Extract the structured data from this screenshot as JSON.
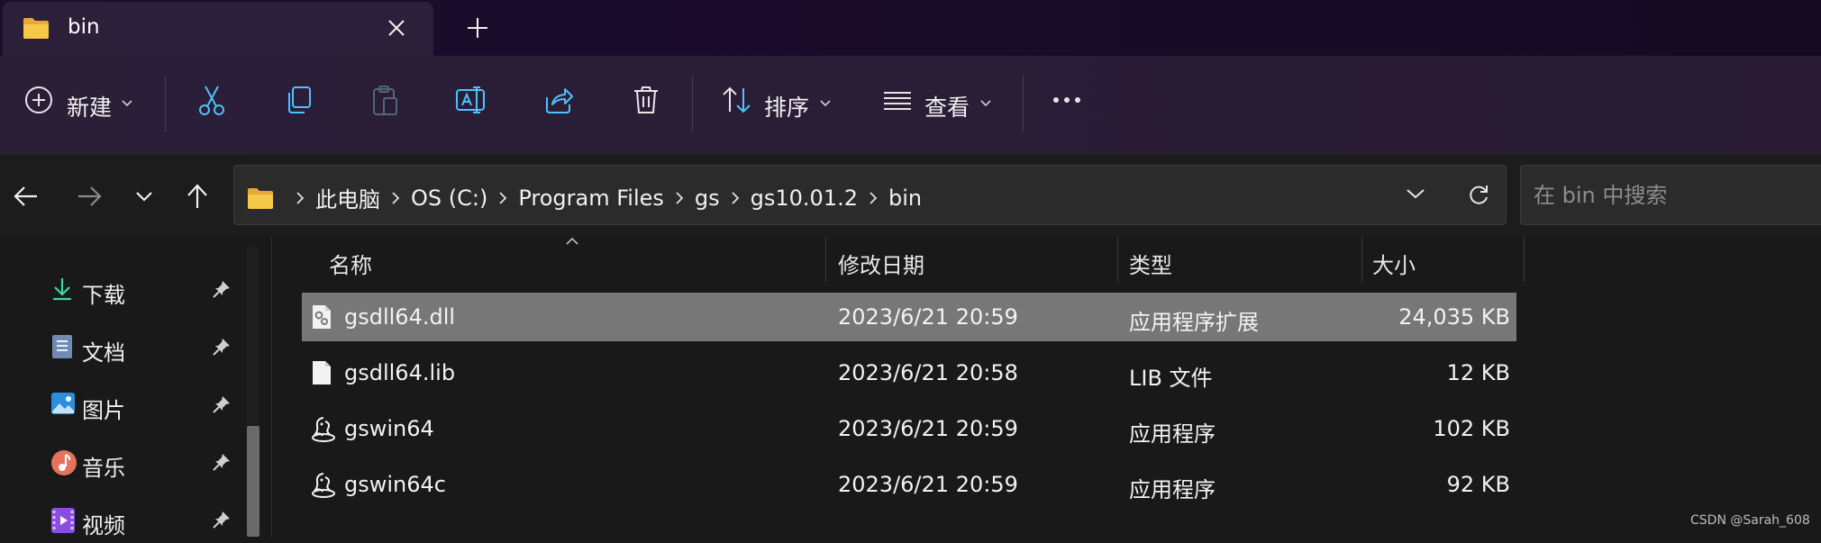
{
  "tab": {
    "title": "bin",
    "icon": "folder-icon"
  },
  "toolbar": {
    "new_label": "新建",
    "sort_label": "排序",
    "view_label": "查看",
    "icons": [
      "new-icon",
      "cut-icon",
      "copy-icon",
      "paste-icon",
      "rename-icon",
      "share-icon",
      "delete-icon",
      "sort-icon",
      "view-icon",
      "more-icon"
    ]
  },
  "address": {
    "crumbs": [
      "此电脑",
      "OS (C:)",
      "Program Files",
      "gs",
      "gs10.01.2",
      "bin"
    ]
  },
  "search": {
    "placeholder": "在 bin 中搜索"
  },
  "sidebar": {
    "items": [
      {
        "label": "下载",
        "icon": "download-icon"
      },
      {
        "label": "文档",
        "icon": "document-icon"
      },
      {
        "label": "图片",
        "icon": "pictures-icon"
      },
      {
        "label": "音乐",
        "icon": "music-icon"
      },
      {
        "label": "视频",
        "icon": "video-icon"
      }
    ]
  },
  "columns": {
    "name": "名称",
    "modified": "修改日期",
    "type": "类型",
    "size": "大小"
  },
  "files": [
    {
      "name": "gsdll64.dll",
      "modified": "2023/6/21 20:59",
      "type": "应用程序扩展",
      "size": "24,035 KB",
      "icon": "dll-file-icon",
      "selected": true
    },
    {
      "name": "gsdll64.lib",
      "modified": "2023/6/21 20:58",
      "type": "LIB 文件",
      "size": "12 KB",
      "icon": "blank-file-icon",
      "selected": false
    },
    {
      "name": "gswin64",
      "modified": "2023/6/21 20:59",
      "type": "应用程序",
      "size": "102 KB",
      "icon": "ghostscript-app-icon",
      "selected": false
    },
    {
      "name": "gswin64c",
      "modified": "2023/6/21 20:59",
      "type": "应用程序",
      "size": "92 KB",
      "icon": "ghostscript-app-icon",
      "selected": false
    }
  ],
  "watermark": "CSDN @Sarah_608",
  "colors": {
    "accent": "#4cc2ff",
    "selected_row": "#777777",
    "folder": "#f3c543"
  }
}
